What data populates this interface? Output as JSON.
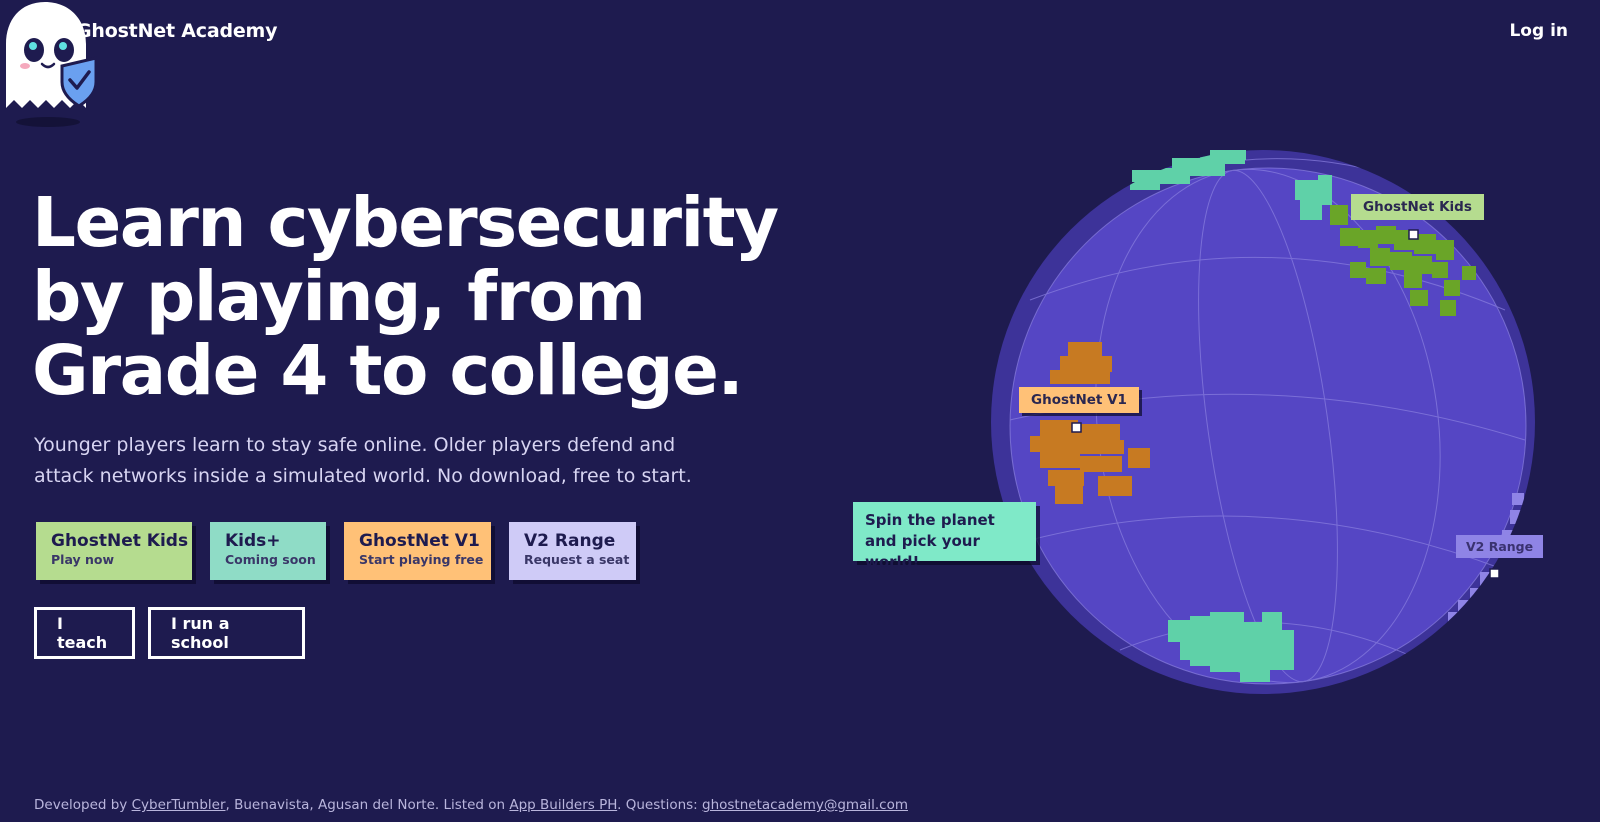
{
  "header": {
    "brand": "GhostNet Academy",
    "login_label": "Log in"
  },
  "hero": {
    "headline": "Learn cybersecurity by playing, from Grade 4 to college.",
    "subline": "Younger players learn to stay safe online. Older players defend and attack networks inside a simulated world. No download, free to start."
  },
  "products": [
    {
      "title": "GhostNet Kids",
      "subtitle": "Play now",
      "color": "#b5dc8f"
    },
    {
      "title": "Kids+",
      "subtitle": "Coming soon",
      "color": "#8fdcc6"
    },
    {
      "title": "GhostNet V1",
      "subtitle": "Start playing free",
      "color": "#ffc177"
    },
    {
      "title": "V2 Range",
      "subtitle": "Request a seat",
      "color": "#cfcbf7"
    }
  ],
  "roles": {
    "teach_label": "I teach",
    "school_label": "I run a school"
  },
  "globe": {
    "callout": "Spin the planet and pick your world!",
    "labels": {
      "kids": "GhostNet Kids",
      "v1": "GhostNet V1",
      "v2": "V2 Range"
    },
    "colors": {
      "ocean": "#5546c4",
      "rim": "#3d3399",
      "teal": "#5fd1a8",
      "green": "#6aa528",
      "orange": "#c77a22",
      "lavender": "#8f84e6"
    }
  },
  "footer": {
    "prefix": "Developed by ",
    "dev_link": "CyberTumbler",
    "location": ", Buenavista, Agusan del Norte. Listed on ",
    "listing_link": "App Builders PH",
    "questions": ". Questions: ",
    "email_link": "ghostnetacademy@gmail.com"
  },
  "icons": {
    "logo": "ghost-icon",
    "mascot": "ghost-mascot-shield-icon"
  }
}
